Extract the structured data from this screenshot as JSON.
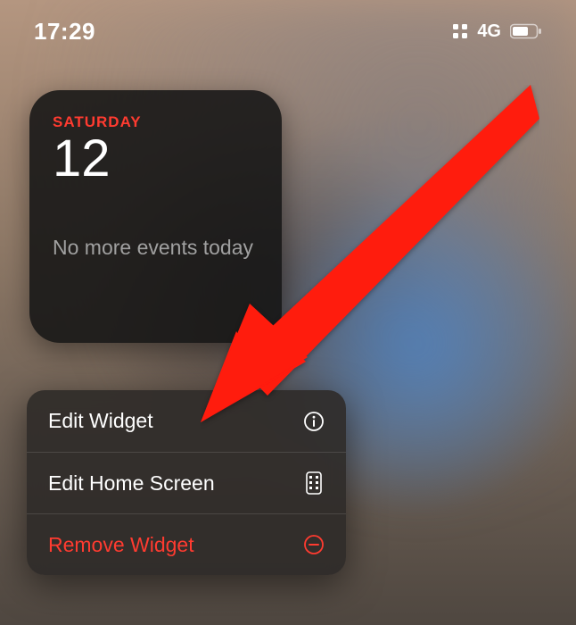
{
  "status": {
    "time": "17:29",
    "network": "4G"
  },
  "widget": {
    "dayName": "SATURDAY",
    "date": "12",
    "eventsText": "No more events today"
  },
  "menu": {
    "editWidget": "Edit Widget",
    "editHome": "Edit Home Screen",
    "remove": "Remove Widget"
  },
  "colors": {
    "accentRed": "#ff3b30"
  }
}
